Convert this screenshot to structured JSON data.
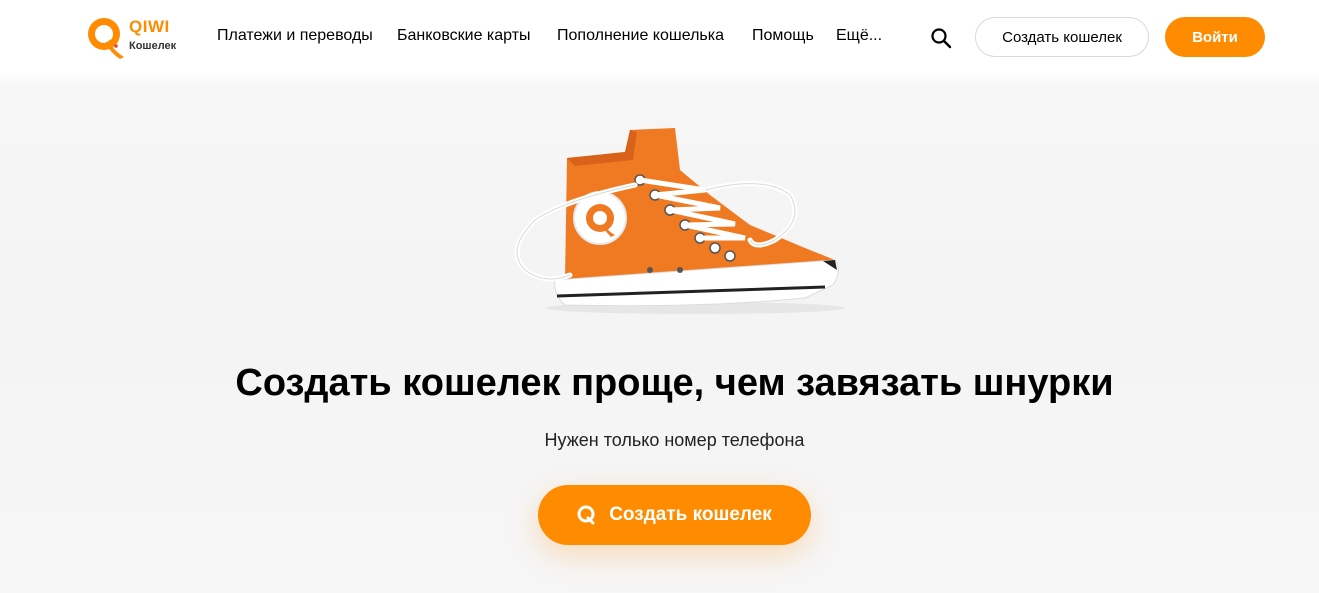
{
  "brand": {
    "name": "QIWI",
    "subtitle": "Кошелек",
    "accent_color": "#ff8c00"
  },
  "nav": {
    "items": [
      {
        "label": "Платежи и переводы"
      },
      {
        "label": "Банковские карты"
      },
      {
        "label": "Пополнение кошелька"
      },
      {
        "label": "Помощь"
      },
      {
        "label": "Ещё..."
      }
    ]
  },
  "header_actions": {
    "search_icon": "search-icon",
    "create_wallet_label": "Создать кошелек",
    "login_label": "Войти"
  },
  "hero": {
    "image": "orange-sneaker-illustration",
    "title": "Создать кошелек проще, чем завязать шнурки",
    "subtitle": "Нужен только номер телефона",
    "cta_label": "Создать кошелек",
    "cta_icon": "qiwi-q-icon"
  }
}
